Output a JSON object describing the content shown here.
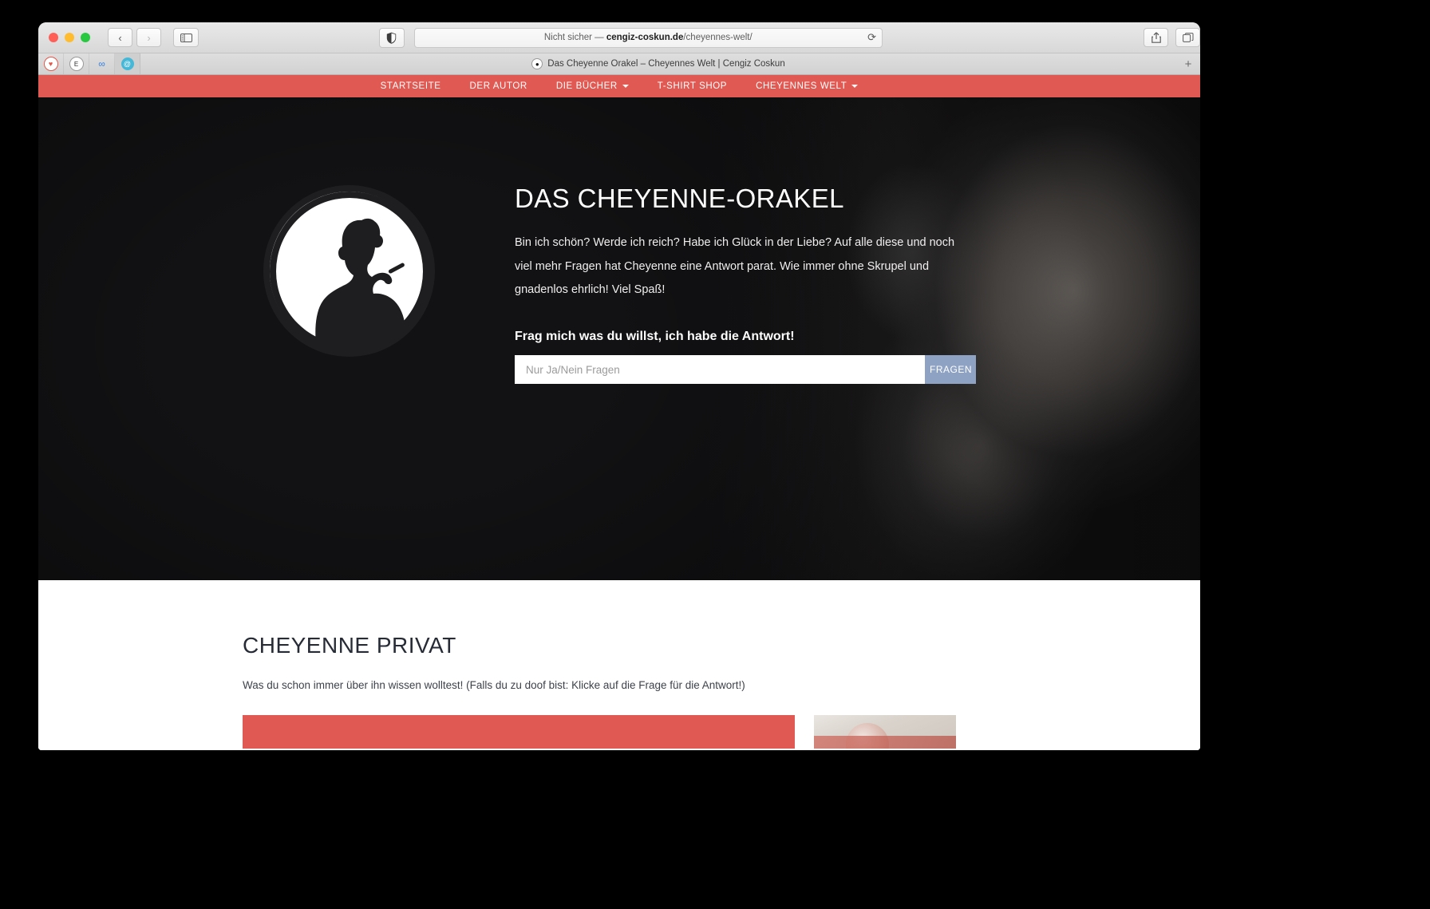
{
  "browser": {
    "traffic_lights": [
      "close",
      "minimize",
      "zoom"
    ],
    "back_label": "‹",
    "forward_label": "›",
    "sidebar_icon": "sidebar-icon",
    "shield_icon": "shield-icon",
    "address": {
      "security_text": "Nicht sicher",
      "separator": "—",
      "host": "cengiz-coskun.de",
      "path": "/cheyennes-welt/",
      "reload_icon": "reload-icon"
    },
    "share_icon": "share-icon",
    "tabs_icon": "tab-overview-icon",
    "new_tab_label": "+",
    "favorites": [
      {
        "name": "favorite-pocket",
        "glyph": "♥",
        "color": "#e2574c",
        "bg": "#ffffff"
      },
      {
        "name": "favorite-evernote",
        "glyph": "E",
        "color": "#2f2f2f",
        "bg": "#ffffff"
      },
      {
        "name": "favorite-link",
        "glyph": "∞",
        "color": "#2f7fe0",
        "bg": "#dcdcdc"
      },
      {
        "name": "favorite-app",
        "glyph": "@",
        "color": "#ffffff",
        "bg": "#45b8d8"
      }
    ],
    "tab": {
      "favicon": "site-favicon",
      "title": "Das Cheyenne Orakel – Cheyennes Welt | Cengiz Coskun"
    }
  },
  "site": {
    "accent_color": "#e05a53",
    "nav": [
      {
        "label": "STARTSEITE",
        "has_caret": false
      },
      {
        "label": "DER AUTOR",
        "has_caret": false
      },
      {
        "label": "DIE BÜCHER",
        "has_caret": true
      },
      {
        "label": "T-SHIRT SHOP",
        "has_caret": false
      },
      {
        "label": "CHEYENNES WELT",
        "has_caret": true
      }
    ],
    "hero": {
      "logo_name": "cheyenne-silhouette-logo",
      "title": "DAS CHEYENNE-ORAKEL",
      "paragraph": "Bin ich schön? Werde ich reich? Habe ich Glück in der Liebe? Auf alle diese und noch viel mehr Fragen hat Cheyenne eine Antwort parat. Wie immer ohne Skrupel und gnadenlos ehrlich! Viel Spaß!",
      "subtitle": "Frag mich was du willst, ich habe die Antwort!",
      "input_placeholder": "Nur Ja/Nein Fragen",
      "input_value": "",
      "button_label": "FRAGEN",
      "button_color": "#8ea2c4"
    },
    "section": {
      "heading": "CHEYENNE PRIVAT",
      "paragraph": "Was du schon immer über ihn wissen wolltest! (Falls du zu doof bist: Klicke auf die Frage für die Antwort!)"
    }
  }
}
